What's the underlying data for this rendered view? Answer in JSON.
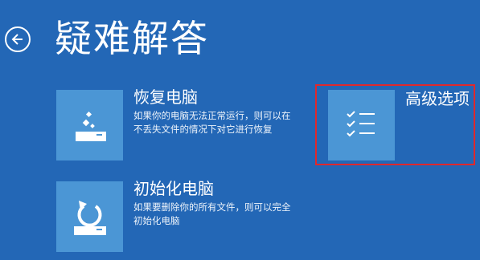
{
  "header": {
    "title": "疑难解答",
    "back_icon": "arrow-left-circle-icon"
  },
  "options": [
    {
      "title": "恢复电脑",
      "desc": "如果你的电脑无法正常运行，则可以在不丢失文件的情况下对它进行恢复",
      "icon": "refresh-sparkle-icon"
    },
    {
      "title": "初始化电脑",
      "desc": "如果要删除你的所有文件，则可以完全初始化电脑",
      "icon": "reset-circular-arrow-icon"
    },
    {
      "title": "高级选项",
      "icon": "checklist-icon"
    }
  ],
  "colors": {
    "background": "#2367b6",
    "tile": "#4b96d5",
    "highlight": "#e0282c"
  }
}
